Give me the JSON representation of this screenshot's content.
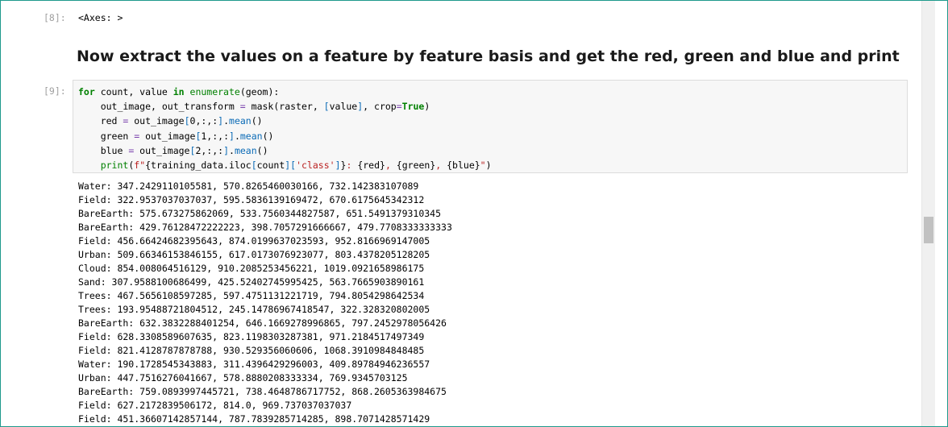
{
  "cells": {
    "cell8": {
      "prompt": "[8]:",
      "output": "<Axes: >"
    },
    "markdown": {
      "heading": "Now extract the values on a feature by feature basis and get the red, green and blue and print"
    },
    "cell9": {
      "prompt": "[9]:",
      "code": [
        "for count, value in enumerate(geom):",
        "    out_image, out_transform = mask(raster, [value], crop=True)",
        "    red = out_image[0,:,:].mean()",
        "    green = out_image[1,:,:].mean()",
        "    blue = out_image[2,:,:].mean()",
        "    print(f\"{training_data.iloc[count]['class']}: {red}, {green}, {blue}\")"
      ],
      "output": [
        "Water: 347.2429110105581, 570.8265460030166, 732.142383107089",
        "Field: 322.9537037037037, 595.5836139169472, 670.6175645342312",
        "BareEarth: 575.673275862069, 533.7560344827587, 651.5491379310345",
        "BareEarth: 429.76128472222223, 398.7057291666667, 479.7708333333333",
        "Field: 456.66424682395643, 874.0199637023593, 952.8166969147005",
        "Urban: 509.66346153846155, 617.0173076923077, 803.4378205128205",
        "Cloud: 854.008064516129, 910.2085253456221, 1019.0921658986175",
        "Sand: 307.9588100686499, 425.52402745995425, 563.7665903890161",
        "Trees: 467.5656108597285, 597.4751131221719, 794.8054298642534",
        "Trees: 193.95488721804512, 245.14786967418547, 322.328320802005",
        "BareEarth: 632.3832288401254, 646.1669278996865, 797.2452978056426",
        "Field: 628.3308589607635, 823.1198303287381, 971.2184517497349",
        "Field: 821.4128787878788, 930.529356060606, 1068.3910984848485",
        "Water: 190.1728545343883, 311.4396429296003, 409.89784946236557",
        "Urban: 447.7516276041667, 578.8880208333334, 769.9345703125",
        "BareEarth: 759.0893997445721, 738.4648786717752, 868.2605363984675",
        "Field: 627.2172839506172, 814.0, 969.737037037037",
        "Field: 451.36607142857144, 787.7839285714285, 898.7071428571429"
      ]
    }
  },
  "colors": {
    "frame_border": "#1e9a8c",
    "prompt": "#a0a0a0",
    "keyword": "#008000",
    "string": "#ba2121",
    "operator": "#7a40ad",
    "code_background": "#f7f7f7",
    "scrollbar_thumb": "#c1c1c1"
  }
}
